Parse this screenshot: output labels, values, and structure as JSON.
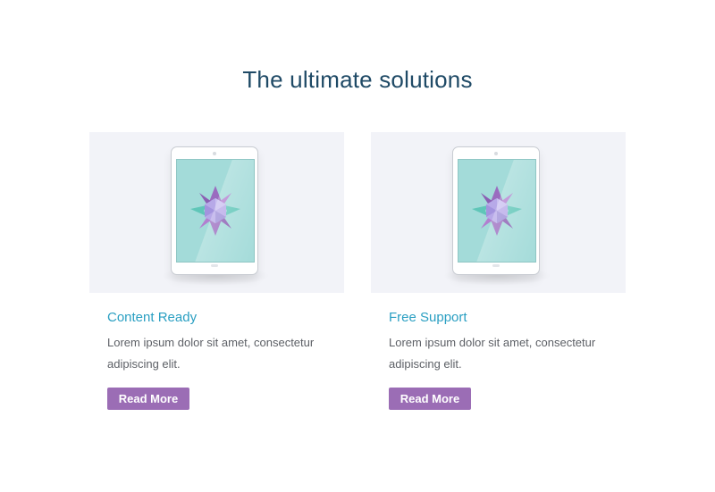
{
  "section": {
    "title": "The ultimate solutions"
  },
  "cards": [
    {
      "title": "Content Ready",
      "text": "Lorem ipsum dolor sit amet, consectetur adipiscing elit.",
      "button_label": "Read More",
      "image_icon": "tablet-icon"
    },
    {
      "title": "Free Support",
      "text": "Lorem ipsum dolor sit amet, consectetur adipiscing elit.",
      "button_label": "Read More",
      "image_icon": "tablet-icon"
    }
  ],
  "colors": {
    "heading": "#1f4a66",
    "card_title": "#2a9fc2",
    "body_text": "#5d6066",
    "button": "#9b6db5",
    "media_bg": "#f2f3f8",
    "screen": "#a3dbd9"
  }
}
